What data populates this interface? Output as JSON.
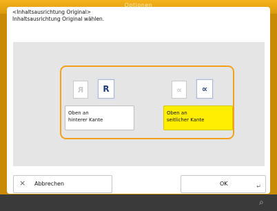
{
  "window": {
    "title": "Optionen"
  },
  "dialog": {
    "title": "<Inhaltsausrichtung Original>",
    "subtitle": "Inhaltsausrichtung Original wählen."
  },
  "options": [
    {
      "icon_ghost": "R",
      "icon_main": "R",
      "label_line1": "Oben an",
      "label_line2": "hinterer Kante",
      "selected": false
    },
    {
      "icon_ghost": "∝",
      "icon_main": "∝",
      "label_line1": "Oben an",
      "label_line2": "seitlicher Kante",
      "selected": true
    }
  ],
  "buttons": {
    "cancel_icon": "×",
    "cancel_label": "Abbrechen",
    "ok_label": "OK",
    "ok_icon": "↵"
  },
  "footer": {
    "icon": "⌕"
  },
  "colors": {
    "accent_orange": "#f2a11c",
    "selected_yellow": "#ffee00",
    "panel_gray": "#e5e5e5",
    "footer_dark": "#3a3a3a"
  }
}
